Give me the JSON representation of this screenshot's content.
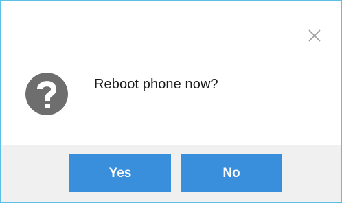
{
  "dialog": {
    "message": "Reboot phone now?",
    "icon": "question-icon",
    "close_icon": "close-icon",
    "buttons": {
      "yes_label": "Yes",
      "no_label": "No"
    },
    "colors": {
      "border": "#5cc0e6",
      "button": "#3a8fdc",
      "footer": "#f0f0f0",
      "icon": "#6e6e6e"
    }
  }
}
